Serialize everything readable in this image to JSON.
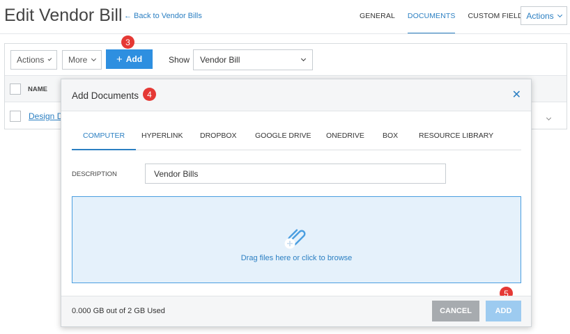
{
  "header": {
    "title": "Edit Vendor Bill",
    "back_link": "Back to Vendor Bills",
    "tabs": [
      {
        "label": "GENERAL",
        "active": false
      },
      {
        "label": "DOCUMENTS",
        "active": true
      },
      {
        "label": "CUSTOM FIELDS",
        "active": false
      }
    ],
    "actions_label": "Actions"
  },
  "toolbar": {
    "actions_label": "Actions",
    "more_label": "More",
    "add_label": "Add",
    "show_label": "Show",
    "show_value": "Vendor Bill"
  },
  "table": {
    "columns": [
      "NAME"
    ],
    "rows": [
      {
        "name": "Design D"
      }
    ]
  },
  "callouts": [
    "3",
    "4",
    "5"
  ],
  "modal": {
    "title": "Add Documents",
    "tabs": [
      {
        "label": "COMPUTER",
        "active": true
      },
      {
        "label": "HYPERLINK",
        "active": false
      },
      {
        "label": "DROPBOX",
        "active": false
      },
      {
        "label": "GOOGLE DRIVE",
        "active": false
      },
      {
        "label": "ONEDRIVE",
        "active": false
      },
      {
        "label": "BOX",
        "active": false
      },
      {
        "label": "RESOURCE LIBRARY",
        "active": false
      }
    ],
    "description_label": "DESCRIPTION",
    "description_value": "Vendor Bills",
    "dropzone_text": "Drag files here or click to browse",
    "storage_text": "0.000 GB out of 2 GB Used",
    "cancel_label": "CANCEL",
    "add_label": "ADD"
  },
  "colors": {
    "accent": "#2e8fe0",
    "link": "#2b7fc2",
    "callout": "#e53935",
    "dropzone_bg": "#e5f1fb"
  },
  "icons": [
    "back-arrow-icon",
    "chevron-down-icon",
    "plus-icon",
    "close-icon",
    "paperclip-icon"
  ]
}
